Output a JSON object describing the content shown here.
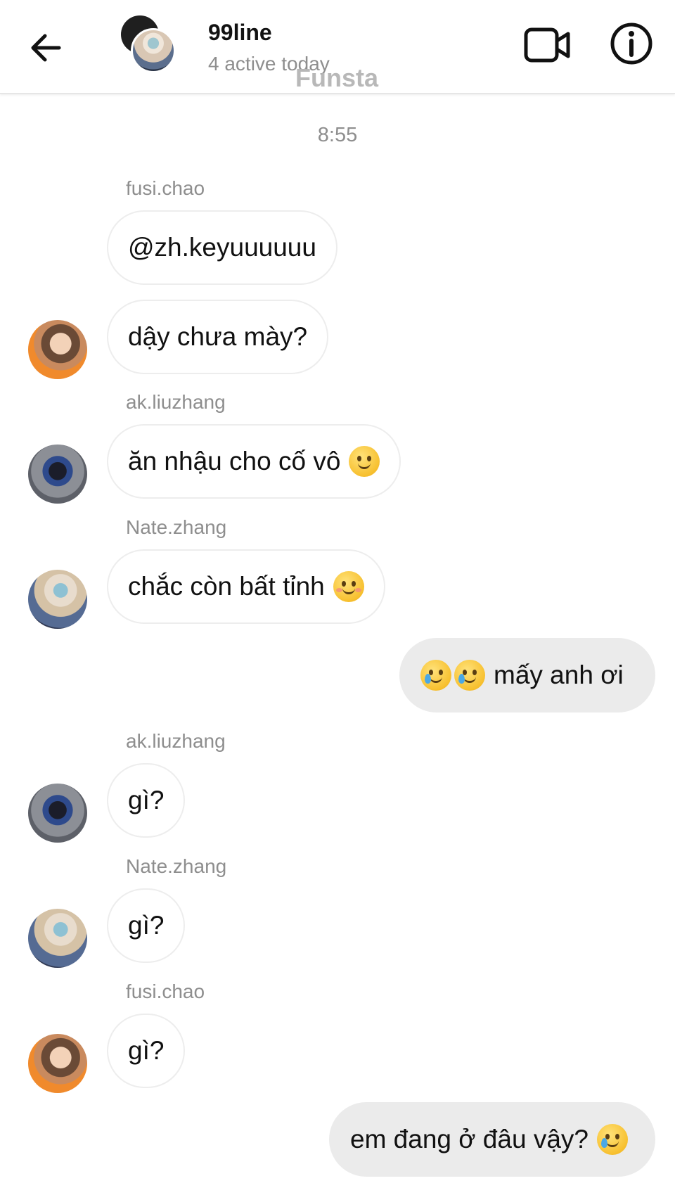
{
  "header": {
    "title": "99line",
    "subtitle": "4 active today",
    "watermark": "Funsta"
  },
  "icons": {
    "back": "arrow-left-icon",
    "video": "video-camera-icon",
    "info": "info-circle-icon"
  },
  "timestamp": "8:55",
  "messages": [
    {
      "sender": "fusi.chao",
      "text": "@zh.keyuuuuuu"
    },
    {
      "text": "dậy chưa mày?"
    },
    {
      "sender": "ak.liuzhang",
      "text": "ăn nhậu cho cố vô"
    },
    {
      "sender": "Nate.zhang",
      "text": "chắc còn bất tỉnh"
    },
    {
      "text": "mấy anh ơi"
    },
    {
      "sender": "ak.liuzhang",
      "text": "gì?"
    },
    {
      "sender": "Nate.zhang",
      "text": "gì?"
    },
    {
      "sender": "fusi.chao",
      "text": "gì?"
    },
    {
      "text": "em đang ở đâu vậy?"
    }
  ],
  "emoji_names": [
    "slightly-smiling-face",
    "smiling-face",
    "smiling-face-with-tear"
  ]
}
